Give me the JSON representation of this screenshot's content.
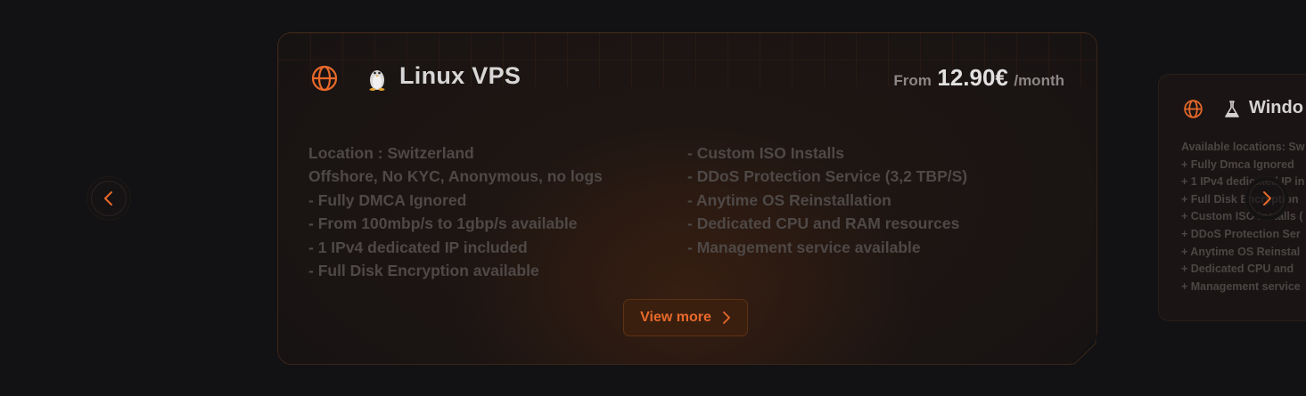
{
  "carousel": {
    "prev_icon": "chevron-left-icon",
    "next_icon": "chevron-right-icon",
    "accent_color": "#e8692a"
  },
  "main_card": {
    "title": "Linux VPS",
    "globe_icon": "globe-icon",
    "os_icon": "linux-penguin-icon",
    "price": {
      "prefix": "From",
      "amount": "12.90€",
      "suffix": "/month"
    },
    "features_left": [
      "Location : Switzerland",
      "Offshore, No KYC, Anonymous, no logs",
      "- Fully DMCA Ignored",
      "- From 100mbp/s to 1gbp/s available",
      "- 1 IPv4 dedicated IP included",
      "- Full Disk Encryption available"
    ],
    "features_right": [
      "- Custom ISO Installs",
      "- DDoS Protection Service (3,2 TBP/S)",
      "- Anytime OS Reinstallation",
      "- Dedicated CPU and RAM resources",
      "- Management service available"
    ],
    "cta_label": "View more"
  },
  "side_card": {
    "title": "Windo",
    "globe_icon": "globe-icon",
    "os_icon": "windows-icon",
    "features": [
      "Available locations: Sw",
      "+ Fully Dmca Ignored",
      "+ 1 IPv4 dedicated IP in",
      "+ Full Disk Encryption",
      "+ Custom ISO Installs (",
      "+ DDoS Protection Ser",
      "+ Anytime OS Reinstal",
      "+ Dedicated CPU and",
      "+ Management service"
    ]
  }
}
